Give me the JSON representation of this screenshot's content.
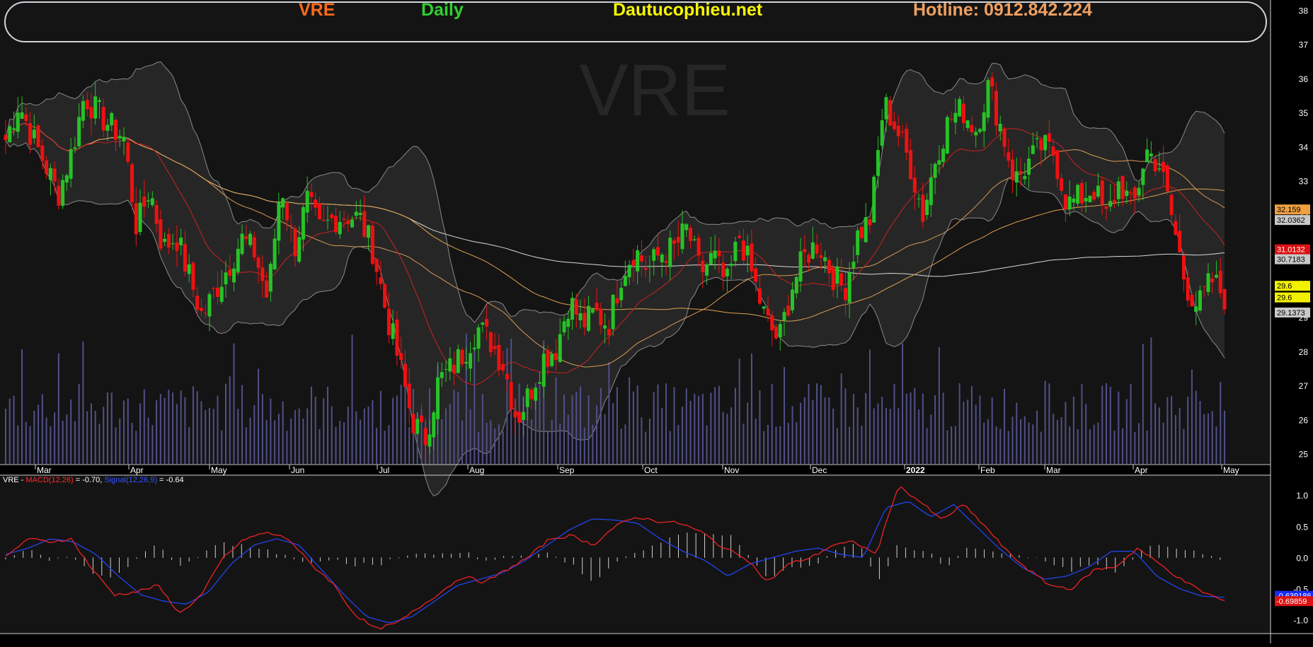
{
  "header": {
    "symbol": "VRE",
    "timeframe": "Daily",
    "site": "Dautucophieu.net",
    "hotline": "Hotline: 0912.842.224"
  },
  "watermark": "VRE",
  "colors": {
    "up": "#27c227",
    "down": "#ee1111",
    "ma_red": "#cc2222",
    "ma_orange": "#e0a050",
    "ma_white": "#d8d8d8",
    "bollinger": "#8a8a8a",
    "volume": "#50508a",
    "macd": "#ee2222",
    "signal": "#2244ee"
  },
  "macd_legend": {
    "prefix": "VRE - ",
    "macd_label": "MACD(12,26)",
    "macd_value": " = -0.70, ",
    "signal_label": "Signal(12,26,9)",
    "signal_value": " = -0.64"
  },
  "chart_data": [
    {
      "type": "candlestick",
      "title": "VRE",
      "x_tick_labels": [
        "Mar",
        "Apr",
        "May",
        "Jun",
        "Jul",
        "Aug",
        "Sep",
        "Oct",
        "Nov",
        "Dec",
        "2022",
        "Feb",
        "Mar",
        "Apr",
        "May"
      ],
      "y_ticks": [
        25,
        26,
        27,
        28,
        29,
        30,
        31,
        32,
        33,
        34,
        35,
        36,
        37,
        38
      ],
      "ylim": [
        24.7,
        38.3
      ],
      "price_labels": [
        {
          "text": "32.159",
          "value": 32.159,
          "bg": "#f0a040",
          "fg": "#000000"
        },
        {
          "text": "32.0362",
          "value": 31.85,
          "bg": "#c8c8c8",
          "fg": "#000000"
        },
        {
          "text": "31.0132",
          "value": 30.99,
          "bg": "#dd1111",
          "fg": "#ffffff"
        },
        {
          "text": "30.7183",
          "value": 30.7,
          "bg": "#c8c8c8",
          "fg": "#000000"
        },
        {
          "text": "29.6",
          "value": 29.92,
          "bg": "#f2f200",
          "fg": "#000000"
        },
        {
          "text": "29.6",
          "value": 29.58,
          "bg": "#f2f200",
          "fg": "#000000"
        },
        {
          "text": "29.1373",
          "value": 29.1373,
          "bg": "#c8c8c8",
          "fg": "#000000"
        }
      ],
      "series": [
        {
          "kind": "candles",
          "anchors": [
            34.2,
            35.3,
            34.3,
            33.5,
            32.6,
            33.8,
            35.5,
            35.0,
            34.6,
            34.3,
            31.6,
            32.8,
            31.0,
            31.4,
            30.2,
            29.0,
            29.8,
            30.5,
            31.3,
            30.9,
            29.5,
            33.0,
            31.0,
            32.4,
            31.5,
            31.9,
            32.0,
            31.9,
            31.0,
            29.2,
            27.7,
            26.0,
            25.4,
            27.1,
            27.5,
            28.0,
            28.7,
            28.3,
            27.6,
            26.0,
            26.8,
            27.8,
            28.1,
            29.5,
            28.8,
            29.1,
            28.8,
            30.3,
            31.0,
            30.4,
            30.9,
            31.0,
            31.6,
            30.3,
            30.8,
            29.9,
            31.4,
            30.2,
            28.9,
            28.3,
            29.9,
            30.8,
            31.2,
            30.3,
            29.8,
            31.4,
            31.9,
            35.3,
            34.5,
            33.5,
            32.0,
            33.8,
            34.8,
            35.1,
            34.5,
            35.8,
            34.5,
            33.0,
            33.5,
            34.0,
            33.8,
            32.3,
            32.5,
            32.8,
            31.9,
            33.0,
            32.1,
            33.9,
            33.5,
            31.9,
            30.0,
            29.3,
            30.1,
            29.6
          ]
        },
        {
          "kind": "volume",
          "note": "volume bars in lower band of price panel"
        }
      ],
      "overlays": [
        "bollinger_bands",
        "MA20 (red)",
        "MA50 (orange)",
        "MA100 (orange)",
        "MA200 (white)"
      ]
    },
    {
      "type": "line",
      "title": "MACD(12,26), Signal(12,26,9)",
      "y_ticks": [
        1.0,
        0.5,
        0.0,
        -0.5,
        -1.0
      ],
      "y_tick_labels": [
        "1.0",
        "0.5",
        "0.0",
        "-0.5",
        "-1.0"
      ],
      "ylim": [
        -1.22,
        1.32
      ],
      "series": [
        {
          "name": "MACD(12,26)",
          "anchors": [
            0.0,
            0.3,
            0.25,
            0.3,
            -0.2,
            -0.6,
            -0.55,
            -0.45,
            -0.9,
            -0.6,
            0.0,
            0.3,
            0.4,
            0.3,
            -0.1,
            -0.4,
            -0.9,
            -1.15,
            -1.05,
            -0.8,
            -0.55,
            -0.3,
            -0.4,
            -0.2,
            0.0,
            0.3,
            0.35,
            0.2,
            0.5,
            0.65,
            0.58,
            0.55,
            0.4,
            0.15,
            0.0,
            -0.4,
            -0.1,
            0.0,
            0.2,
            0.25,
            0.05,
            1.15,
            0.9,
            0.6,
            0.85,
            0.5,
            0.1,
            -0.2,
            -0.45,
            -0.5,
            -0.2,
            -0.15,
            0.15,
            -0.1,
            -0.35,
            -0.55,
            -0.7
          ],
          "last_label": "-0.69859"
        },
        {
          "name": "Signal(12,26,9)",
          "anchors": [
            0.05,
            0.15,
            0.3,
            0.25,
            0.05,
            -0.3,
            -0.6,
            -0.7,
            -0.75,
            -0.55,
            -0.1,
            0.2,
            0.3,
            0.2,
            -0.2,
            -0.6,
            -0.95,
            -1.05,
            -0.95,
            -0.7,
            -0.45,
            -0.35,
            -0.25,
            -0.05,
            0.2,
            0.45,
            0.62,
            0.6,
            0.55,
            0.3,
            0.1,
            -0.05,
            -0.3,
            -0.1,
            0.0,
            0.1,
            0.15,
            0.05,
            0.0,
            0.8,
            0.9,
            0.65,
            0.85,
            0.5,
            0.15,
            -0.15,
            -0.35,
            -0.3,
            -0.15,
            0.1,
            0.1,
            -0.3,
            -0.5,
            -0.62,
            -0.64
          ],
          "last_label": "-0.639186"
        },
        {
          "name": "Histogram",
          "kind": "bars"
        }
      ]
    }
  ]
}
